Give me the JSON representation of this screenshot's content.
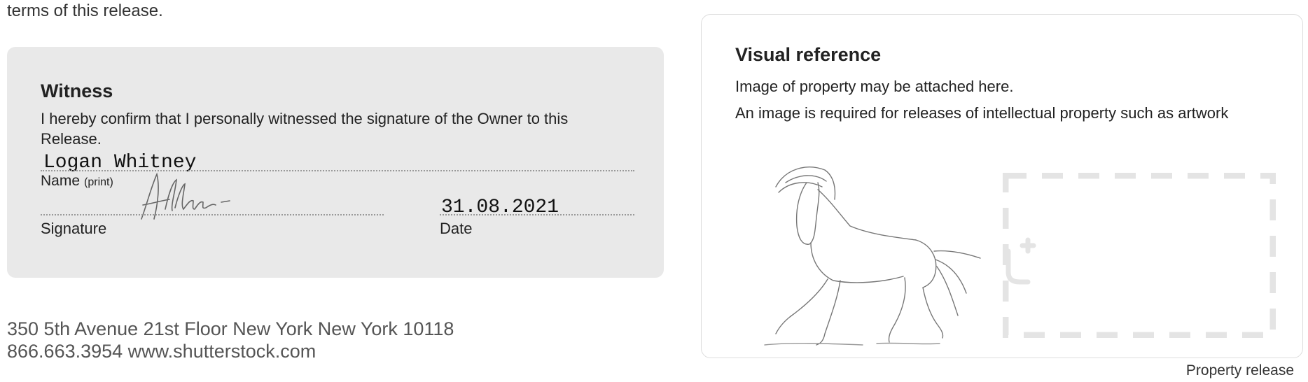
{
  "intro": {
    "tail_text": "terms of this release."
  },
  "witness": {
    "title": "Witness",
    "description": "I hereby confirm that I personally witnessed the signature of the Owner to this Release.",
    "name_value": "Logan Whitney",
    "name_label": "Name",
    "name_label_small": "(print)",
    "signature_label": "Signature",
    "date_value": "31.08.2021",
    "date_label": "Date"
  },
  "address": {
    "line1": "350 5th Avenue  21st Floor  New York  New York 10118",
    "line2": "866.663.3954 www.shutterstock.com"
  },
  "visual_reference": {
    "title": "Visual reference",
    "line1": "Image of property may be attached here.",
    "line2": "An image is required for releases of intellectual property such as artwork"
  },
  "footer": {
    "label": "Property release"
  }
}
